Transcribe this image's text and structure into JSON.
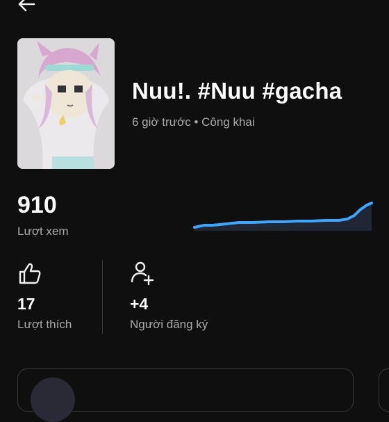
{
  "header": {
    "back_icon": "arrow-left-icon"
  },
  "video": {
    "title": "Nuu!. #Nuu #gacha",
    "meta": "6 giờ trước • Công khai"
  },
  "stats": {
    "views": {
      "count": "910",
      "label": "Lượt xem"
    },
    "likes": {
      "icon": "thumbs-up-icon",
      "count": "17",
      "label": "Lượt thích"
    },
    "subscribers": {
      "icon": "add-person-icon",
      "count": "+4",
      "label": "Người đăng ký"
    }
  },
  "colors": {
    "background": "#0f0f0f",
    "accent_line": "#3ea6ff",
    "secondary_text": "#aaaaaa"
  }
}
